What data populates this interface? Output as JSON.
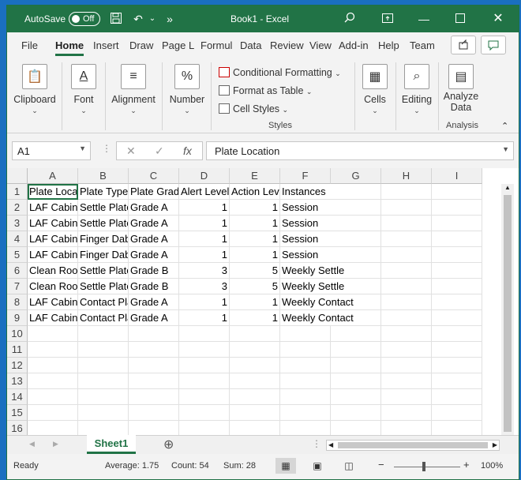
{
  "titlebar": {
    "autosave_label": "AutoSave",
    "autosave_state": "Off",
    "title": "Book1 - Excel"
  },
  "tabs": [
    "File",
    "Home",
    "Insert",
    "Draw",
    "Page L",
    "Formul",
    "Data",
    "Review",
    "View",
    "Add-in",
    "Help",
    "Team"
  ],
  "ribbon": {
    "clipboard": "Clipboard",
    "font": "Font",
    "alignment": "Alignment",
    "number": "Number",
    "conditional_formatting": "Conditional Formatting",
    "format_as_table": "Format as Table",
    "cell_styles": "Cell Styles",
    "styles_group": "Styles",
    "cells": "Cells",
    "editing": "Editing",
    "analyze_data_1": "Analyze",
    "analyze_data_2": "Data",
    "analysis_group": "Analysis"
  },
  "formula_bar": {
    "name_box": "A1",
    "formula": "Plate Location"
  },
  "columns": [
    "A",
    "B",
    "C",
    "D",
    "E",
    "F",
    "G",
    "H",
    "I"
  ],
  "rows": [
    "1",
    "2",
    "3",
    "4",
    "5",
    "6",
    "7",
    "8",
    "9",
    "10",
    "11",
    "12",
    "13",
    "14",
    "15",
    "16"
  ],
  "cells": [
    [
      "Plate Location",
      "Plate Type",
      "Plate Grade",
      "Alert Level",
      "Action Level",
      "Instances"
    ],
    [
      "LAF Cabinet",
      "Settle Plate",
      "Grade A",
      "1",
      "1",
      "Session"
    ],
    [
      "LAF Cabinet",
      "Settle Plate",
      "Grade A",
      "1",
      "1",
      "Session"
    ],
    [
      "LAF Cabinet",
      "Finger Dab",
      "Grade A",
      "1",
      "1",
      "Session"
    ],
    [
      "LAF Cabinet",
      "Finger Dab",
      "Grade A",
      "1",
      "1",
      "Session"
    ],
    [
      "Clean Room",
      "Settle Plate",
      "Grade B",
      "3",
      "5",
      "Weekly Settle"
    ],
    [
      "Clean Room",
      "Settle Plate",
      "Grade B",
      "3",
      "5",
      "Weekly Settle"
    ],
    [
      "LAF Cabinet",
      "Contact Plate",
      "Grade A",
      "1",
      "1",
      "Weekly Contact"
    ],
    [
      "LAF Cabinet",
      "Contact Plate",
      "Grade A",
      "1",
      "1",
      "Weekly Contact"
    ]
  ],
  "sheet_tab": "Sheet1",
  "status": {
    "ready": "Ready",
    "average": "Average: 1.75",
    "count": "Count: 54",
    "sum": "Sum: 28",
    "zoom": "100%"
  },
  "colors": {
    "accent": "#217346"
  }
}
